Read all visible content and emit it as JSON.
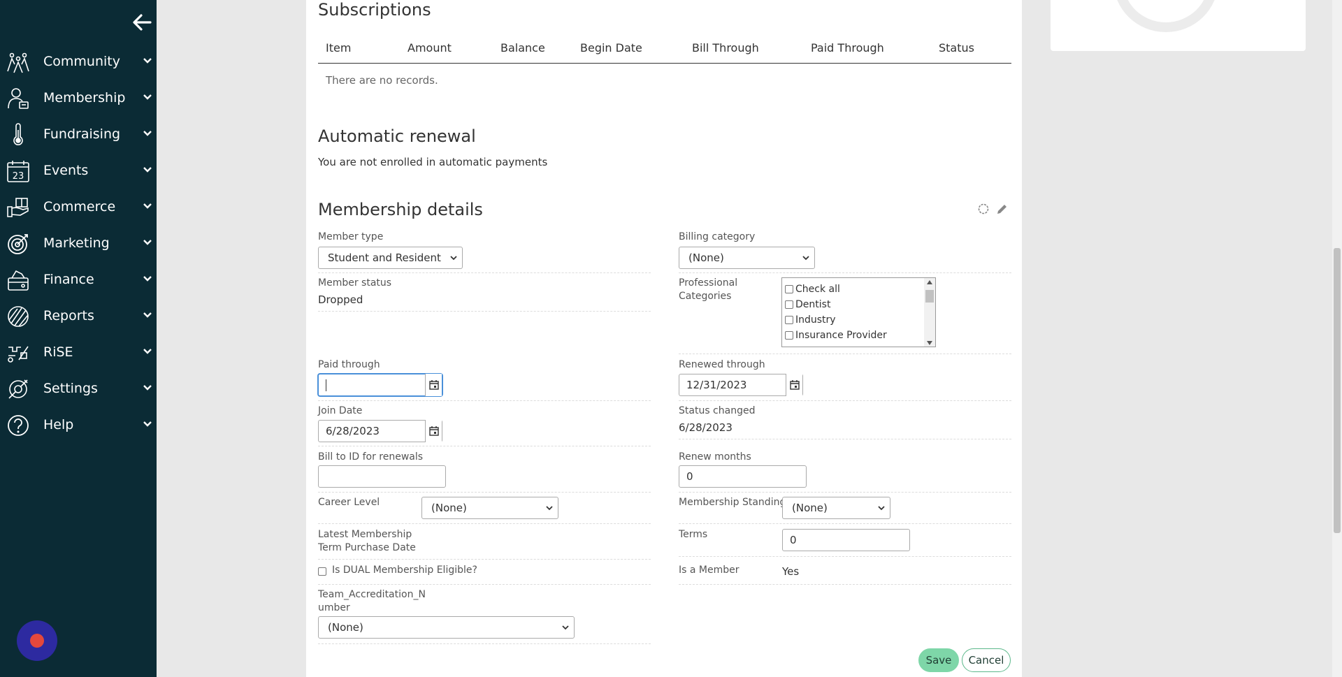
{
  "sidebar": {
    "items": [
      {
        "label": "Community",
        "icon": "community-icon"
      },
      {
        "label": "Membership",
        "icon": "membership-icon"
      },
      {
        "label": "Fundraising",
        "icon": "thermometer-icon"
      },
      {
        "label": "Events",
        "icon": "calendar-icon"
      },
      {
        "label": "Commerce",
        "icon": "commerce-icon"
      },
      {
        "label": "Marketing",
        "icon": "target-icon"
      },
      {
        "label": "Finance",
        "icon": "finance-icon"
      },
      {
        "label": "Reports",
        "icon": "reports-icon"
      },
      {
        "label": "RiSE",
        "icon": "rise-icon"
      },
      {
        "label": "Settings",
        "icon": "settings-icon"
      },
      {
        "label": "Help",
        "icon": "help-icon"
      }
    ],
    "events_day": "23"
  },
  "subscriptions": {
    "title": "Subscriptions",
    "columns": [
      "Item",
      "Amount",
      "Balance",
      "Begin Date",
      "Bill Through",
      "Paid Through",
      "Status"
    ],
    "empty_text": "There are no records."
  },
  "auto_renewal": {
    "title": "Automatic renewal",
    "text": "You are not enrolled in automatic payments"
  },
  "membership_details": {
    "title": "Membership details",
    "member_type": {
      "label": "Member type",
      "value": "Student and Resident"
    },
    "billing_category": {
      "label": "Billing category",
      "value": "(None)"
    },
    "member_status": {
      "label": "Member status",
      "value": "Dropped"
    },
    "professional_categories": {
      "label": "Professional Categories",
      "options": [
        "Check all",
        "Dentist",
        "Industry",
        "Insurance Provider"
      ]
    },
    "paid_through": {
      "label": "Paid through",
      "value": ""
    },
    "renewed_through": {
      "label": "Renewed through",
      "value": "12/31/2023"
    },
    "join_date": {
      "label": "Join Date",
      "value": "6/28/2023"
    },
    "status_changed": {
      "label": "Status changed",
      "value": "6/28/2023"
    },
    "bill_to_id": {
      "label": "Bill to ID for renewals",
      "value": ""
    },
    "renew_months": {
      "label": "Renew months",
      "value": "0"
    },
    "career_level": {
      "label": "Career Level",
      "value": "(None)"
    },
    "membership_standing": {
      "label": "Membership Standing",
      "value": "(None)"
    },
    "latest_term_purchase": {
      "label_line1": "Latest Membership",
      "label_line2": "Term Purchase Date"
    },
    "terms": {
      "label": "Terms",
      "value": "0"
    },
    "dual_eligible": {
      "label": "Is DUAL Membership Eligible?",
      "checked": false
    },
    "is_member": {
      "label": "Is a Member",
      "value": "Yes"
    },
    "team_accreditation": {
      "label_line1": "Team_Accreditation_N",
      "label_line2": "umber",
      "value": "(None)"
    }
  },
  "actions": {
    "save": "Save",
    "cancel": "Cancel"
  },
  "colors": {
    "sidebar_bg": "#0b2b35",
    "save_bg": "#7ed6a8",
    "cancel_border": "#5bb88a",
    "chat_bg": "#2d2aa0",
    "chat_dot": "#e4483c"
  }
}
